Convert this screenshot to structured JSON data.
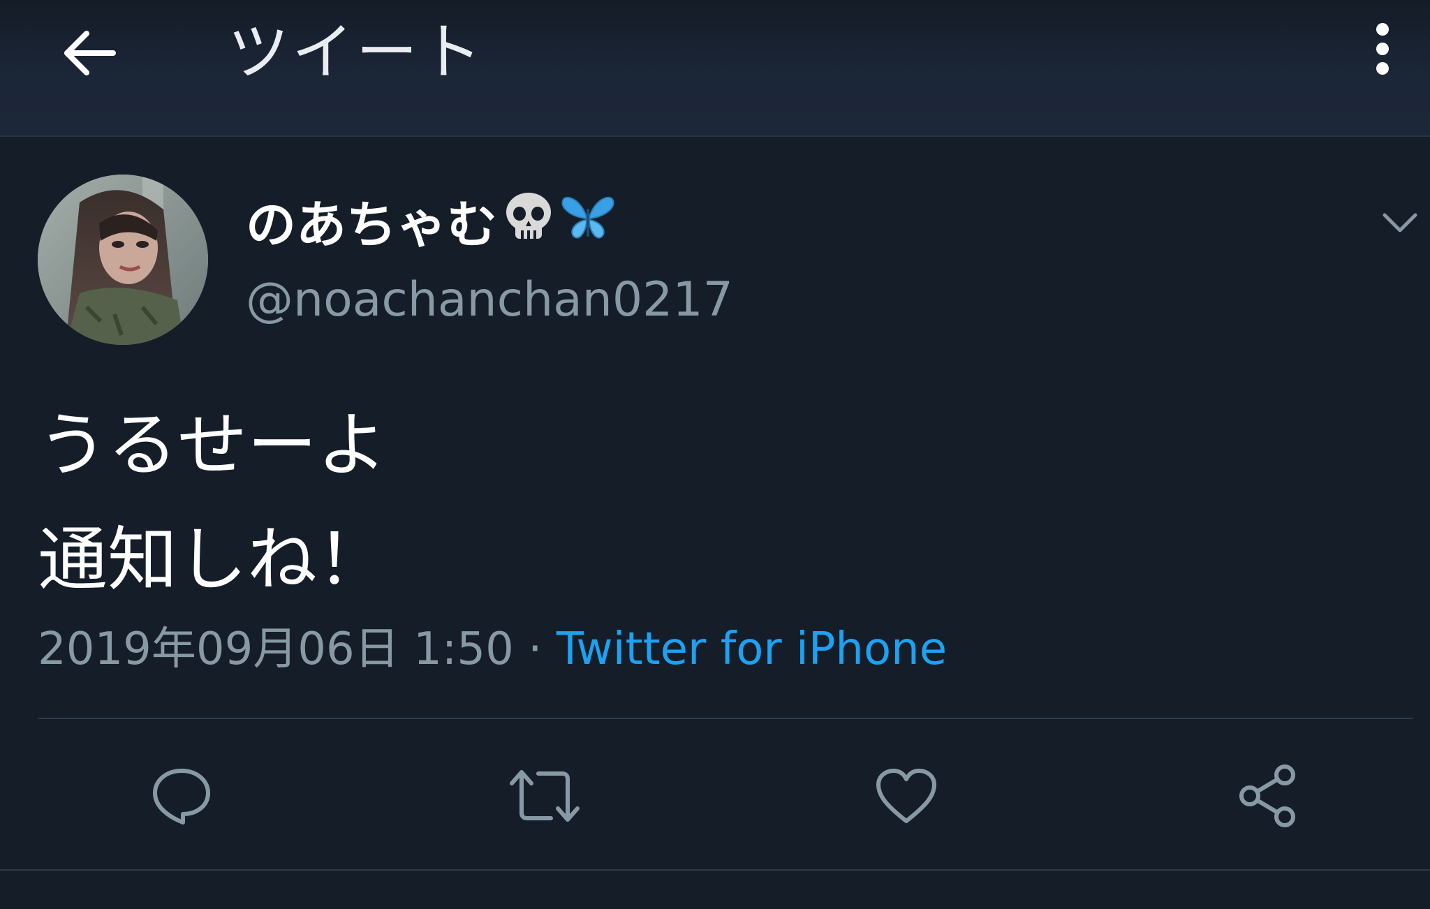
{
  "header": {
    "title": "ツイート",
    "back_icon": "arrow-left-icon",
    "menu_icon": "more-vertical-icon"
  },
  "tweet": {
    "display_name": "のあちゃむ",
    "name_emojis": [
      "skull-emoji",
      "butterfly-emoji"
    ],
    "handle": "@noachanchan0217",
    "text_lines": [
      "うるせーよ",
      "通知しね！"
    ],
    "date_time": "2019年09月06日 1:50",
    "separator": "·",
    "source": "Twitter for iPhone"
  },
  "actions": [
    {
      "name": "reply",
      "icon": "reply-icon"
    },
    {
      "name": "retweet",
      "icon": "retweet-icon"
    },
    {
      "name": "like",
      "icon": "heart-icon"
    },
    {
      "name": "share",
      "icon": "share-icon"
    }
  ],
  "colors": {
    "background": "#151e28",
    "header": "#1c2739",
    "text_primary": "#ffffff",
    "text_secondary": "#8899a6",
    "accent": "#1da1f2",
    "divider": "#2b3a4b"
  }
}
